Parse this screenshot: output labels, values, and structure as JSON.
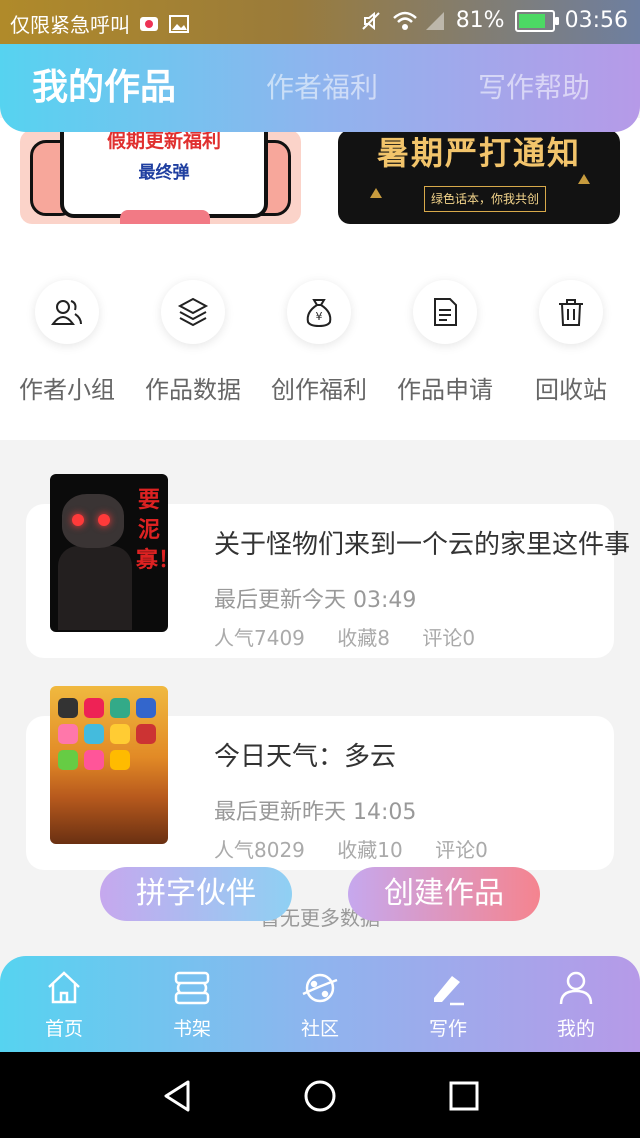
{
  "status_bar": {
    "notification_text": "仅限紧急呼叫",
    "battery_percent": "81%",
    "battery_level": 0.81,
    "time": "03:56"
  },
  "header": {
    "tabs": [
      {
        "label": "我的作品",
        "active": true
      },
      {
        "label": "作者福利",
        "active": false
      },
      {
        "label": "写作帮助",
        "active": false
      }
    ]
  },
  "banners": [
    {
      "line1": "假期更新福利",
      "line2": "最终弹"
    },
    {
      "line1": "暑期严打通知",
      "line2": "绿色话本，你我共创"
    }
  ],
  "quick_actions": [
    {
      "label": "作者小组",
      "icon": "people-icon"
    },
    {
      "label": "作品数据",
      "icon": "layers-icon"
    },
    {
      "label": "创作福利",
      "icon": "money-bag-icon"
    },
    {
      "label": "作品申请",
      "icon": "document-icon"
    },
    {
      "label": "回收站",
      "icon": "trash-icon"
    }
  ],
  "works": [
    {
      "title": "关于怪物们来到一个云的家里这件事",
      "updated": "最后更新今天 03:49",
      "popularity": "人气7409",
      "favorites": "收藏8",
      "comments": "评论0",
      "cover_text": "要泥寡！"
    },
    {
      "title": "今日天气：多云",
      "updated": "最后更新昨天 14:05",
      "popularity": "人气8029",
      "favorites": "收藏10",
      "comments": "评论0"
    }
  ],
  "no_more_text": "暂无更多数据",
  "floating_buttons": {
    "left": "拼字伙伴",
    "right": "创建作品"
  },
  "bottom_nav": [
    {
      "label": "首页",
      "icon": "home-icon"
    },
    {
      "label": "书架",
      "icon": "bookshelf-icon"
    },
    {
      "label": "社区",
      "icon": "planet-icon"
    },
    {
      "label": "写作",
      "icon": "pen-icon"
    },
    {
      "label": "我的",
      "icon": "user-icon"
    }
  ],
  "colors": {
    "accent_start": "#56d3f0",
    "accent_end": "#b69ae8",
    "create_button_end": "#f5848f"
  }
}
